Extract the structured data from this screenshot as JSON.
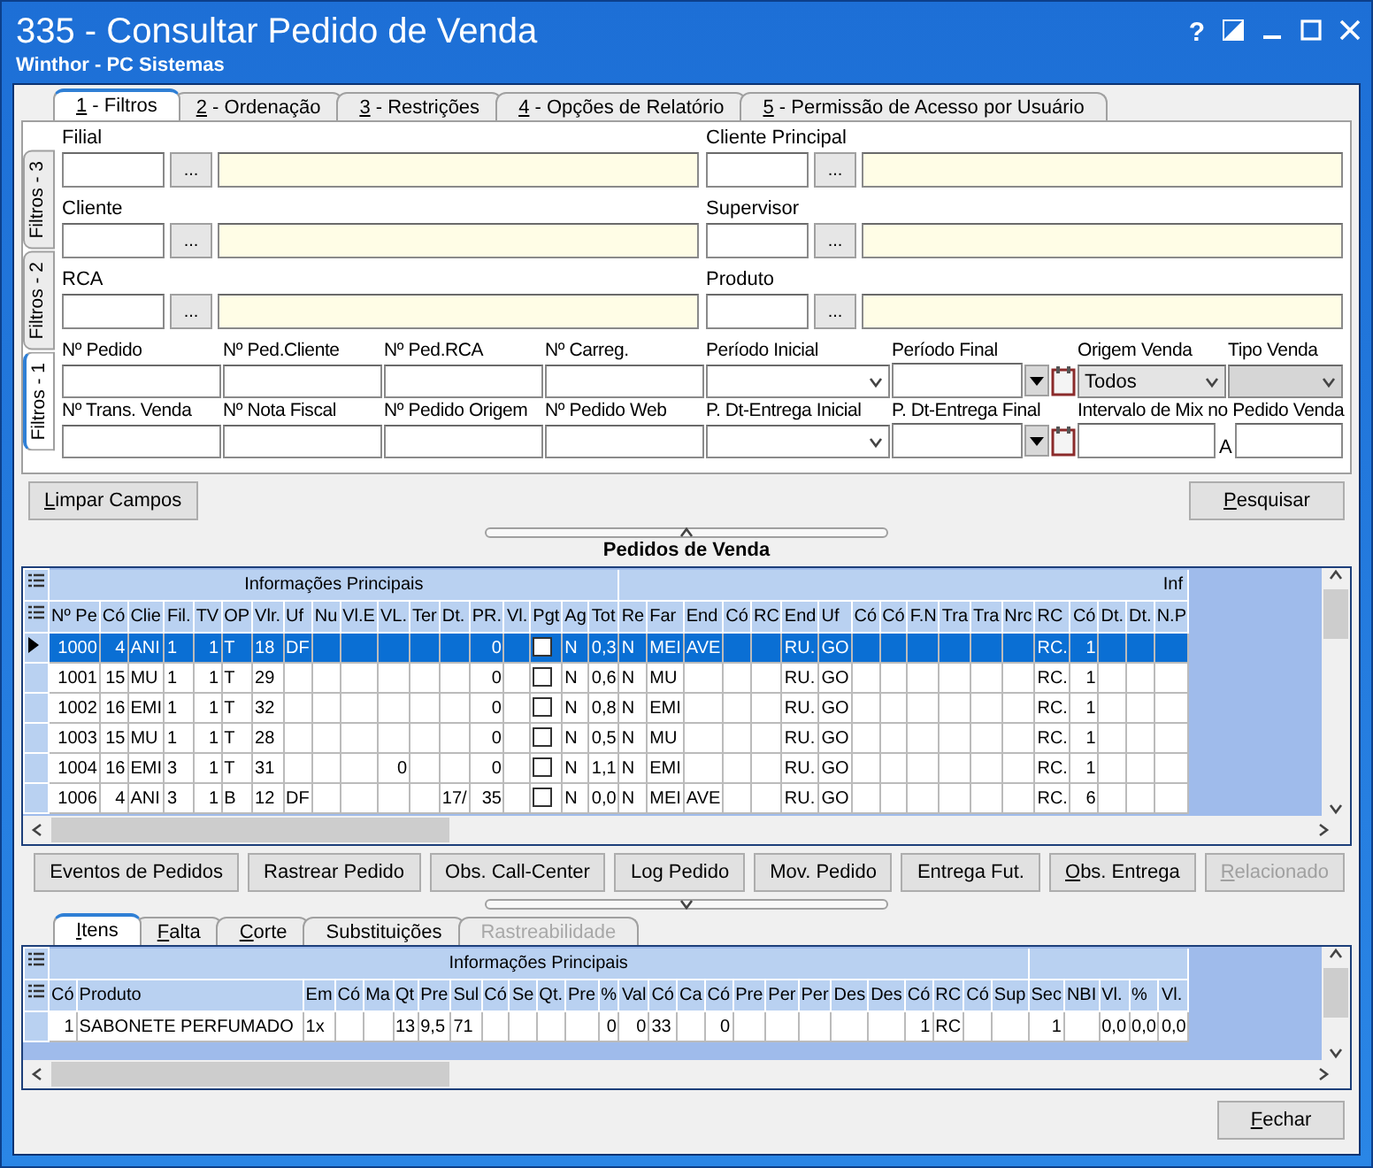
{
  "window": {
    "title": "335 - Consultar Pedido de Venda",
    "subtitle": "Winthor - PC Sistemas",
    "help": "?"
  },
  "tabs": [
    {
      "label": "1 - Filtros",
      "selected": true,
      "mnemonic": true
    },
    {
      "label": "2 - Ordenação",
      "selected": false,
      "mnemonic": true
    },
    {
      "label": "3 - Restrições",
      "selected": false,
      "mnemonic": true
    },
    {
      "label": "4 - Opções de Relatório",
      "selected": false,
      "mnemonic": true
    },
    {
      "label": "5 - Permissão de Acesso por Usuário",
      "selected": false,
      "mnemonic": true
    }
  ],
  "side_tabs": [
    {
      "label": "Filtros - 3",
      "selected": false
    },
    {
      "label": "Filtros - 2",
      "selected": false
    },
    {
      "label": "Filtros - 1",
      "selected": true
    }
  ],
  "lookups": [
    {
      "label": "Filial"
    },
    {
      "label": "Cliente Principal"
    },
    {
      "label": "Cliente"
    },
    {
      "label": "Supervisor"
    },
    {
      "label": "RCA"
    },
    {
      "label": "Produto"
    }
  ],
  "lookup_button": "...",
  "fields": [
    {
      "label": "Nº Pedido",
      "kind": "text"
    },
    {
      "label": "Nº Ped.Cliente",
      "kind": "text"
    },
    {
      "label": "Nº Ped.RCA",
      "kind": "text"
    },
    {
      "label": "Nº Carreg.",
      "kind": "text"
    },
    {
      "label": "Período Inicial",
      "kind": "select",
      "disabled": false
    },
    {
      "label": "Período Final",
      "kind": "date"
    },
    {
      "label": "Origem Venda",
      "kind": "select",
      "value": "Todos",
      "disabled": false
    },
    {
      "label": "Tipo Venda",
      "kind": "select",
      "disabled": true
    },
    {
      "label": "Nº Trans. Venda",
      "kind": "text"
    },
    {
      "label": "Nº Nota Fiscal",
      "kind": "text"
    },
    {
      "label": "Nº Pedido Origem",
      "kind": "text"
    },
    {
      "label": "Nº Pedido Web",
      "kind": "text"
    },
    {
      "label": "P. Dt-Entrega Inicial",
      "kind": "select",
      "disabled": false
    },
    {
      "label": "P. Dt-Entrega Final",
      "kind": "date"
    },
    {
      "label": "Intervalo de Mix no Pedido Venda",
      "kind": "range",
      "separator": "A"
    }
  ],
  "clear_button": {
    "label": "Limpar Campos",
    "mnemonic": true
  },
  "search_button": {
    "label": "Pesquisar",
    "mnemonic": true
  },
  "orders": {
    "title": "Pedidos de Venda",
    "groups": [
      "Informações Principais",
      "Inf"
    ],
    "columns": [
      "Nº Pe",
      "Có",
      "Clie",
      "Fil.",
      "TV",
      "OP",
      "Vlr.",
      "Uf",
      "Nu",
      "Vl.E",
      "VL.",
      "Ter",
      "Dt.",
      "PR.",
      "Vl.",
      "Pgt",
      "Ag",
      "Tot",
      "Re",
      "Far",
      "End",
      "Có",
      "RC",
      "End",
      "Uf",
      "Có",
      "Có",
      "F.N",
      "Tra",
      "Tra",
      "Nrc",
      "RC",
      "Có",
      "Dt.",
      "Dt.",
      "N.P"
    ],
    "rows": [
      {
        "selected": true,
        "cells": [
          "1000",
          "4",
          "ANI",
          "1",
          "1",
          "T",
          "18",
          "DF",
          "",
          "",
          "",
          "",
          "",
          "0",
          "",
          {
            "checked": false
          },
          "N",
          "0,3",
          "N",
          "MEI",
          "AVE",
          "",
          "",
          "RU.",
          "GO",
          "",
          "",
          "",
          "",
          "",
          "",
          "RC.",
          "1",
          "",
          "",
          ""
        ]
      },
      {
        "selected": false,
        "cells": [
          "1001",
          "15",
          "MU",
          "1",
          "1",
          "T",
          "29",
          "",
          "",
          "",
          "",
          "",
          "",
          "0",
          "",
          {
            "checked": false
          },
          "N",
          "0,6",
          "N",
          "MU",
          "",
          "",
          "",
          "RU.",
          "GO",
          "",
          "",
          "",
          "",
          "",
          "",
          "RC.",
          "1",
          "",
          "",
          ""
        ]
      },
      {
        "selected": false,
        "cells": [
          "1002",
          "16",
          "EMI",
          "1",
          "1",
          "T",
          "32",
          "",
          "",
          "",
          "",
          "",
          "",
          "0",
          "",
          {
            "checked": false
          },
          "N",
          "0,8",
          "N",
          "EMI",
          "",
          "",
          "",
          "RU.",
          "GO",
          "",
          "",
          "",
          "",
          "",
          "",
          "RC.",
          "1",
          "",
          "",
          ""
        ]
      },
      {
        "selected": false,
        "cells": [
          "1003",
          "15",
          "MU",
          "1",
          "1",
          "T",
          "28",
          "",
          "",
          "",
          "",
          "",
          "",
          "0",
          "",
          {
            "checked": false
          },
          "N",
          "0,5",
          "N",
          "MU",
          "",
          "",
          "",
          "RU.",
          "GO",
          "",
          "",
          "",
          "",
          "",
          "",
          "RC.",
          "1",
          "",
          "",
          ""
        ]
      },
      {
        "selected": false,
        "cells": [
          "1004",
          "16",
          "EMI",
          "3",
          "1",
          "T",
          "31",
          "",
          "",
          "",
          "0",
          "",
          "",
          "0",
          "",
          {
            "checked": false
          },
          "N",
          "1,1",
          "N",
          "EMI",
          "",
          "",
          "",
          "RU.",
          "GO",
          "",
          "",
          "",
          "",
          "",
          "",
          "RC.",
          "1",
          "",
          "",
          ""
        ]
      },
      {
        "selected": false,
        "cells": [
          "1006",
          "4",
          "ANI",
          "3",
          "1",
          "B",
          "12",
          "DF",
          "",
          "",
          "",
          "",
          "17/",
          "35",
          "",
          {
            "checked": false
          },
          "N",
          "0,0",
          "N",
          "MEI",
          "AVE",
          "",
          "",
          "RU.",
          "GO",
          "",
          "",
          "",
          "",
          "",
          "",
          "RC.",
          "6",
          "",
          "",
          ""
        ]
      }
    ]
  },
  "actions": [
    {
      "label": "Eventos de Pedidos",
      "disabled": false,
      "mnemonic": false
    },
    {
      "label": "Rastrear Pedido",
      "disabled": false,
      "mnemonic": false
    },
    {
      "label": "Obs. Call-Center",
      "disabled": false,
      "mnemonic": false
    },
    {
      "label": "Log Pedido",
      "disabled": false,
      "mnemonic": false
    },
    {
      "label": "Mov. Pedido",
      "disabled": false,
      "mnemonic": false
    },
    {
      "label": "Entrega Fut.",
      "disabled": false,
      "mnemonic": false
    },
    {
      "label": "Obs. Entrega",
      "disabled": false,
      "mnemonic": true
    },
    {
      "label": "Relacionado",
      "disabled": true,
      "mnemonic": true
    }
  ],
  "detail_tabs": [
    {
      "label": "Itens",
      "selected": true,
      "disabled": false,
      "mnemonic": true
    },
    {
      "label": "Falta",
      "selected": false,
      "disabled": false,
      "mnemonic": true
    },
    {
      "label": "Corte",
      "selected": false,
      "disabled": false,
      "mnemonic": true
    },
    {
      "label": "Substituições",
      "selected": false,
      "disabled": false,
      "mnemonic": false
    },
    {
      "label": "Rastreabilidade",
      "selected": false,
      "disabled": true,
      "mnemonic": false
    }
  ],
  "items": {
    "groups": [
      "Informações Principais"
    ],
    "columns": [
      "Có",
      "Produto",
      "Em",
      "Có",
      "Ma",
      "Qt",
      "Pre",
      "Sul",
      "Có",
      "Se",
      "Qt.",
      "Pre",
      "%",
      "Val",
      "Có",
      "Ca",
      "Có",
      "Pre",
      "Per",
      "Per",
      "Des",
      "Des",
      "Có",
      "RC",
      "Có",
      "Sup",
      "Sec",
      "NBI",
      "Vl.",
      "%",
      "Vl."
    ],
    "rows": [
      {
        "selected": false,
        "cells": [
          "1",
          "SABONETE PERFUMADO",
          "1x",
          "",
          "",
          "13",
          "9,5",
          "71",
          "",
          "",
          "",
          "",
          "0",
          "0",
          "33",
          "",
          "0",
          "",
          "",
          "",
          "",
          "",
          "1",
          "RC",
          "",
          "",
          "1",
          "",
          "0,0",
          "0,0",
          "0,0"
        ]
      }
    ]
  },
  "close_button": {
    "label": "Fechar",
    "mnemonic": true
  }
}
